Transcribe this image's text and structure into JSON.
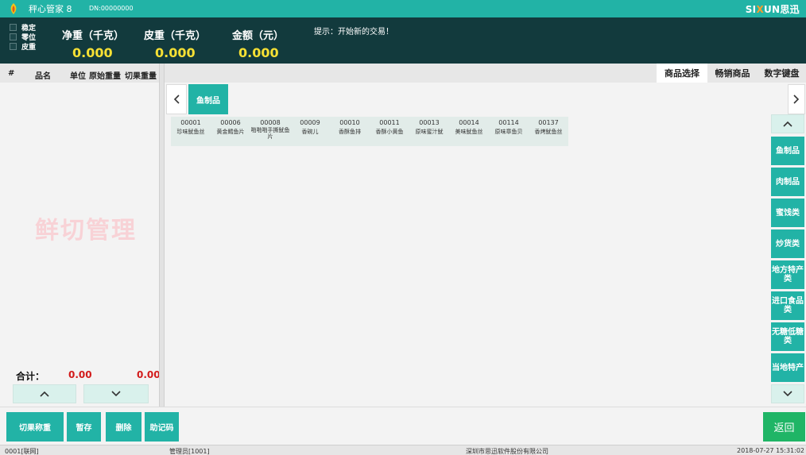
{
  "titlebar": {
    "app_name": "秤心管家 8",
    "dn": "DN:00000000",
    "brand_a": "SI",
    "brand_x": "X",
    "brand_b": "UN思迅"
  },
  "scale": {
    "status": [
      "稳定",
      "零位",
      "皮重"
    ],
    "net_label": "净重（千克）",
    "net_value": "0.000",
    "tare_label": "皮重（千克）",
    "tare_value": "0.000",
    "amount_label": "金额（元）",
    "amount_value": "0.000",
    "hint": "提示：开始新的交易！"
  },
  "order_list": {
    "headers": [
      "#",
      "品名",
      "单位",
      "原始重量",
      "切果重量"
    ],
    "watermark": "鲜切管理",
    "total_label": "合计：",
    "total_orig": "0.00",
    "total_cut": "0.00"
  },
  "tabs": [
    "商品选择",
    "畅销商品",
    "数字键盘"
  ],
  "active_tab": 0,
  "category_pill": "鱼制品",
  "products": [
    {
      "code": "00001",
      "name": "珍味鱿鱼丝"
    },
    {
      "code": "00006",
      "name": "黄金鳕鱼片"
    },
    {
      "code": "00008",
      "name": "啪啪啪手撕鱿鱼片"
    },
    {
      "code": "00009",
      "name": "香碗儿"
    },
    {
      "code": "00010",
      "name": "香酥鱼排"
    },
    {
      "code": "00011",
      "name": "香酥小黄鱼"
    },
    {
      "code": "00013",
      "name": "原味蜜汁鱿"
    },
    {
      "code": "00014",
      "name": "美味鱿鱼丝"
    },
    {
      "code": "00114",
      "name": "原味章鱼贝"
    },
    {
      "code": "00137",
      "name": "香烤鱿鱼丝"
    }
  ],
  "categories": [
    "鱼制品",
    "肉制品",
    "蜜饯类",
    "炒货类",
    "地方特产类",
    "进口食品类",
    "无糖低糖类",
    "当地特产"
  ],
  "actions": [
    "切果称重",
    "暂存",
    "删除",
    "助记码"
  ],
  "back_label": "返回",
  "statusbar": {
    "store": "0001[联网]",
    "user": "管理员[1001]",
    "company": "深圳市思迅软件股份有限公司",
    "datetime": "2018-07-27 15:31:02"
  },
  "colors": {
    "accent": "#22b3a6",
    "scale_bg": "#123a3d",
    "value_yellow": "#f6e034",
    "total_red": "#d21b1b",
    "back_green": "#1fb566",
    "brand_orange": "#ff9c2a"
  },
  "icons": {
    "logo": "scale-logo-icon",
    "prev": "chevron-left-icon",
    "next": "chevron-right-icon",
    "up": "chevron-up-icon",
    "down": "chevron-down-icon"
  }
}
